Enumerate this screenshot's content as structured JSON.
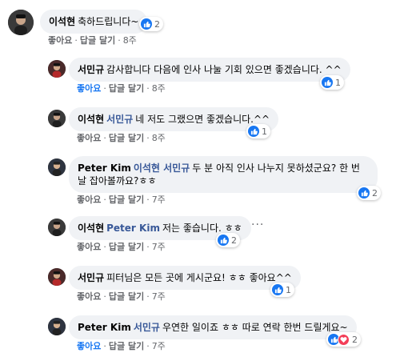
{
  "comments": [
    {
      "author": "이석현",
      "tag": "",
      "text": "축하드립니다~",
      "reaction_count": "2",
      "like_label": "좋아요",
      "reply_label": "답글 달기",
      "time": "8주",
      "liked": false
    },
    {
      "author": "서민규",
      "tag": "",
      "text": "감사합니다 다음에 인사 나눌 기회 있으면 좋겠습니다. ^^",
      "reaction_count": "1",
      "like_label": "좋아요",
      "reply_label": "답글 달기",
      "time": "8주",
      "liked": true
    },
    {
      "author": "이석현",
      "tag": "서민규",
      "text": "네 저도 그랬으면 좋겠습니다.^^",
      "reaction_count": "1",
      "like_label": "좋아요",
      "reply_label": "답글 달기",
      "time": "8주",
      "liked": false
    },
    {
      "author": "Peter Kim",
      "tag": "이석현 서민규",
      "text": "두 분 아직 인사 나누지 못하셨군요? 한 번 날 잡아볼까요?ㅎㅎ",
      "reaction_count": "2",
      "like_label": "좋아요",
      "reply_label": "답글 달기",
      "time": "7주",
      "liked": false
    },
    {
      "author": "이석현",
      "tag": "Peter Kim",
      "text": "저는 좋습니다. ㅎㅎ",
      "reaction_count": "2",
      "like_label": "좋아요",
      "reply_label": "답글 달기",
      "time": "7주",
      "liked": false
    },
    {
      "author": "서민규",
      "tag": "",
      "text": "피터님은 모든 곳에 게시군요! ㅎㅎ 좋아요^^",
      "reaction_count": "1",
      "like_label": "좋아요",
      "reply_label": "답글 달기",
      "time": "7주",
      "liked": false
    },
    {
      "author": "Peter Kim",
      "tag": "서민규",
      "text": "우연한 일이죠 ㅎㅎ 따로 연락 한번 드릴게요~",
      "reaction_count": "2",
      "like_label": "좋아요",
      "reply_label": "답글 달기",
      "time": "7주",
      "liked": true
    }
  ],
  "colors": {
    "bubble": "#f0f2f5",
    "name": "#050505",
    "tag": "#385898",
    "like_active": "#1877f2",
    "meta": "#65676b",
    "love": "#f33e58"
  },
  "icons": [
    "like-reaction-icon",
    "love-reaction-icon",
    "more-options-icon"
  ]
}
